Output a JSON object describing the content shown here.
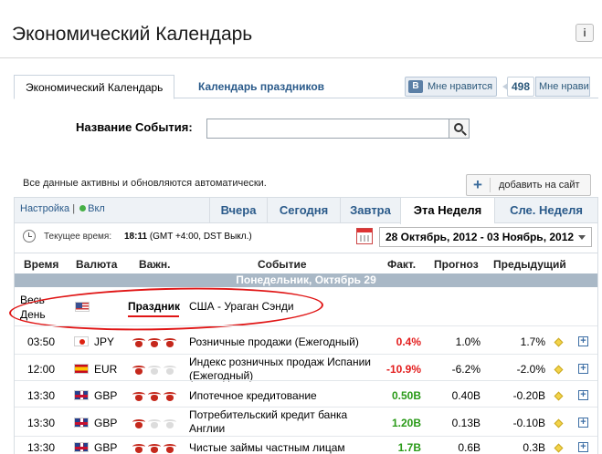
{
  "page": {
    "title": "Экономический Календарь",
    "info_icon": "info-icon"
  },
  "tabs": [
    {
      "label": "Экономический Календарь",
      "active": true
    },
    {
      "label": "Календарь праздников",
      "active": false
    }
  ],
  "social": {
    "vk_logo": "B",
    "like_label": "Мне нравится",
    "like_count": "498",
    "like_label_2": "Мне нравится"
  },
  "search": {
    "label": "Название События:",
    "value": "",
    "placeholder": ""
  },
  "notice": "Все данные активны и обновляются автоматически.",
  "add_site": {
    "label": "добавить на сайт",
    "icon": "plus-icon"
  },
  "toolbar": {
    "settings_label": "Настройка",
    "separator": "|",
    "status_label": "Вкл",
    "status_color": "#46b046",
    "days": [
      {
        "label": "Вчера",
        "active": false
      },
      {
        "label": "Сегодня",
        "active": false
      },
      {
        "label": "Завтра",
        "active": false
      },
      {
        "label": "Эта Неделя",
        "active": true
      },
      {
        "label": "Сле. Неделя",
        "active": false
      }
    ]
  },
  "timebar": {
    "label": "Текущее время:",
    "time": "18:11",
    "zone": "(GMT +4:00, DST Выкл.)",
    "range": "28 Октябрь, 2012 - 03 Ноябрь, 2012"
  },
  "columns": {
    "time": "Время",
    "currency": "Валюта",
    "importance": "Важн.",
    "event": "Событие",
    "actual": "Факт.",
    "forecast": "Прогноз",
    "previous": "Предыдущий"
  },
  "day_header": "Понедельник, Октябрь 29",
  "holiday": {
    "time": "Весь День",
    "flag": "us",
    "label": "Праздник",
    "title": "США - Ураган Сэнди"
  },
  "events": [
    {
      "time": "03:50",
      "flag": "jp",
      "currency": "JPY",
      "importance": 3,
      "event": "Розничные продажи (Ежегодный)",
      "actual": "0.4%",
      "actual_style": "neg",
      "forecast": "1.0%",
      "previous": "1.7%"
    },
    {
      "time": "12:00",
      "flag": "es",
      "currency": "EUR",
      "importance": 1,
      "event": "Индекс розничных продаж Испании (Ежегодный)",
      "actual": "-10.9%",
      "actual_style": "neg",
      "forecast": "-6.2%",
      "previous": "-2.0%"
    },
    {
      "time": "13:30",
      "flag": "gb",
      "currency": "GBP",
      "importance": 3,
      "event": "Ипотечное кредитование",
      "actual": "0.50B",
      "actual_style": "pos",
      "forecast": "0.40B",
      "previous": "-0.20B"
    },
    {
      "time": "13:30",
      "flag": "gb",
      "currency": "GBP",
      "importance": 1,
      "event": "Потребительский кредит банка Англии",
      "actual": "1.20B",
      "actual_style": "pos",
      "forecast": "0.13B",
      "previous": "-0.10B"
    },
    {
      "time": "13:30",
      "flag": "gb",
      "currency": "GBP",
      "importance": 3,
      "event": "Чистые займы частным лицам",
      "actual": "1.7B",
      "actual_style": "pos",
      "forecast": "0.6B",
      "previous": "0.3B"
    }
  ]
}
